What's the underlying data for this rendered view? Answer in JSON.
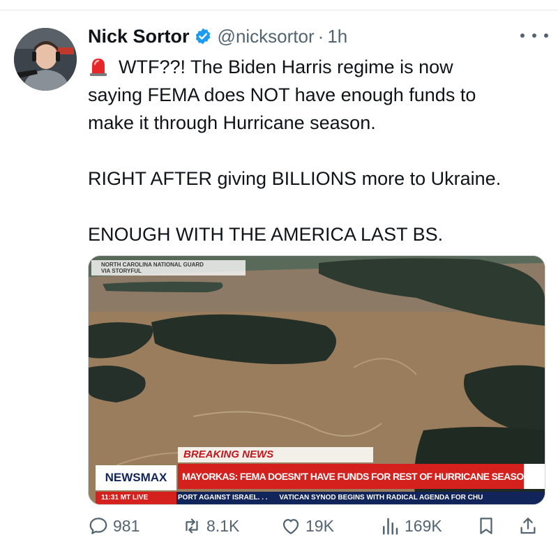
{
  "author": {
    "name": "Nick Sortor",
    "handle": "@nicksortor",
    "separator": "·",
    "time": "1h"
  },
  "tweet": {
    "lines": [
      "WTF??! The Biden Harris regime is now",
      "saying FEMA does NOT have enough funds to",
      "make it through Hurricane season.",
      "RIGHT AFTER giving BILLIONS more to Ukraine.",
      "ENOUGH WITH THE AMERICA LAST BS."
    ],
    "emoji_icon": "police-light-icon"
  },
  "media": {
    "credit_line1": "NORTH CAROLINA NATIONAL GUARD",
    "credit_line2": "VIA STORYFUL",
    "breaking_label": "BREAKING NEWS",
    "network_logo": "NEWSMAX",
    "headline": "MAYORKAS: FEMA DOESN'T HAVE FUNDS FOR REST OF HURRICANE SEASON",
    "ticker_time": "11:31 MT  LIVE",
    "ticker_item1": "PORT AGAINST ISRAEL. . .",
    "ticker_item2": "VATICAN SYNOD BEGINS WITH RADICAL AGENDA FOR CHU"
  },
  "actions": {
    "replies": "981",
    "reposts": "8.1K",
    "likes": "19K",
    "views": "169K",
    "icons": [
      "reply-icon",
      "repost-icon",
      "like-icon",
      "views-icon",
      "bookmark-icon",
      "share-icon"
    ]
  },
  "colors": {
    "verified_blue": "#1d9bf0",
    "secondary_text": "#536471",
    "newsmax_red": "#d5211e",
    "newsmax_navy": "#12255a"
  }
}
